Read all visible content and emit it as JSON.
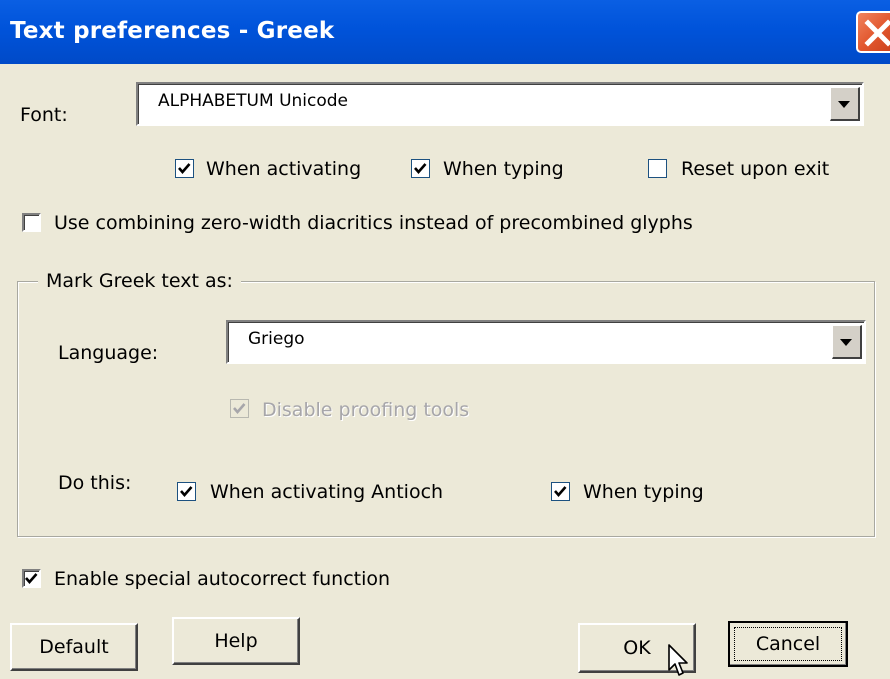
{
  "window": {
    "title": "Text preferences - Greek"
  },
  "font": {
    "label": "Font:",
    "value": "ALPHABETUM Unicode",
    "when_activating": {
      "label": "When activating",
      "checked": true
    },
    "when_typing": {
      "label": "When typing",
      "checked": true
    },
    "reset_upon_exit": {
      "label": "Reset upon exit",
      "checked": false
    }
  },
  "combining": {
    "label": "Use combining zero-width diacritics instead of precombined glyphs",
    "checked": false
  },
  "mark_group": {
    "title": "Mark Greek text as:",
    "language_label": "Language:",
    "language_value": "Griego",
    "disable_proofing": {
      "label": "Disable proofing tools",
      "checked": true,
      "enabled": false
    },
    "do_this_label": "Do this:",
    "when_activating_antioch": {
      "label": "When activating Antioch",
      "checked": true
    },
    "when_typing": {
      "label": "When typing",
      "checked": true
    }
  },
  "autocorrect": {
    "label": "Enable special autocorrect function",
    "checked": true
  },
  "buttons": {
    "default": "Default",
    "help": "Help",
    "ok": "OK",
    "cancel": "Cancel"
  }
}
